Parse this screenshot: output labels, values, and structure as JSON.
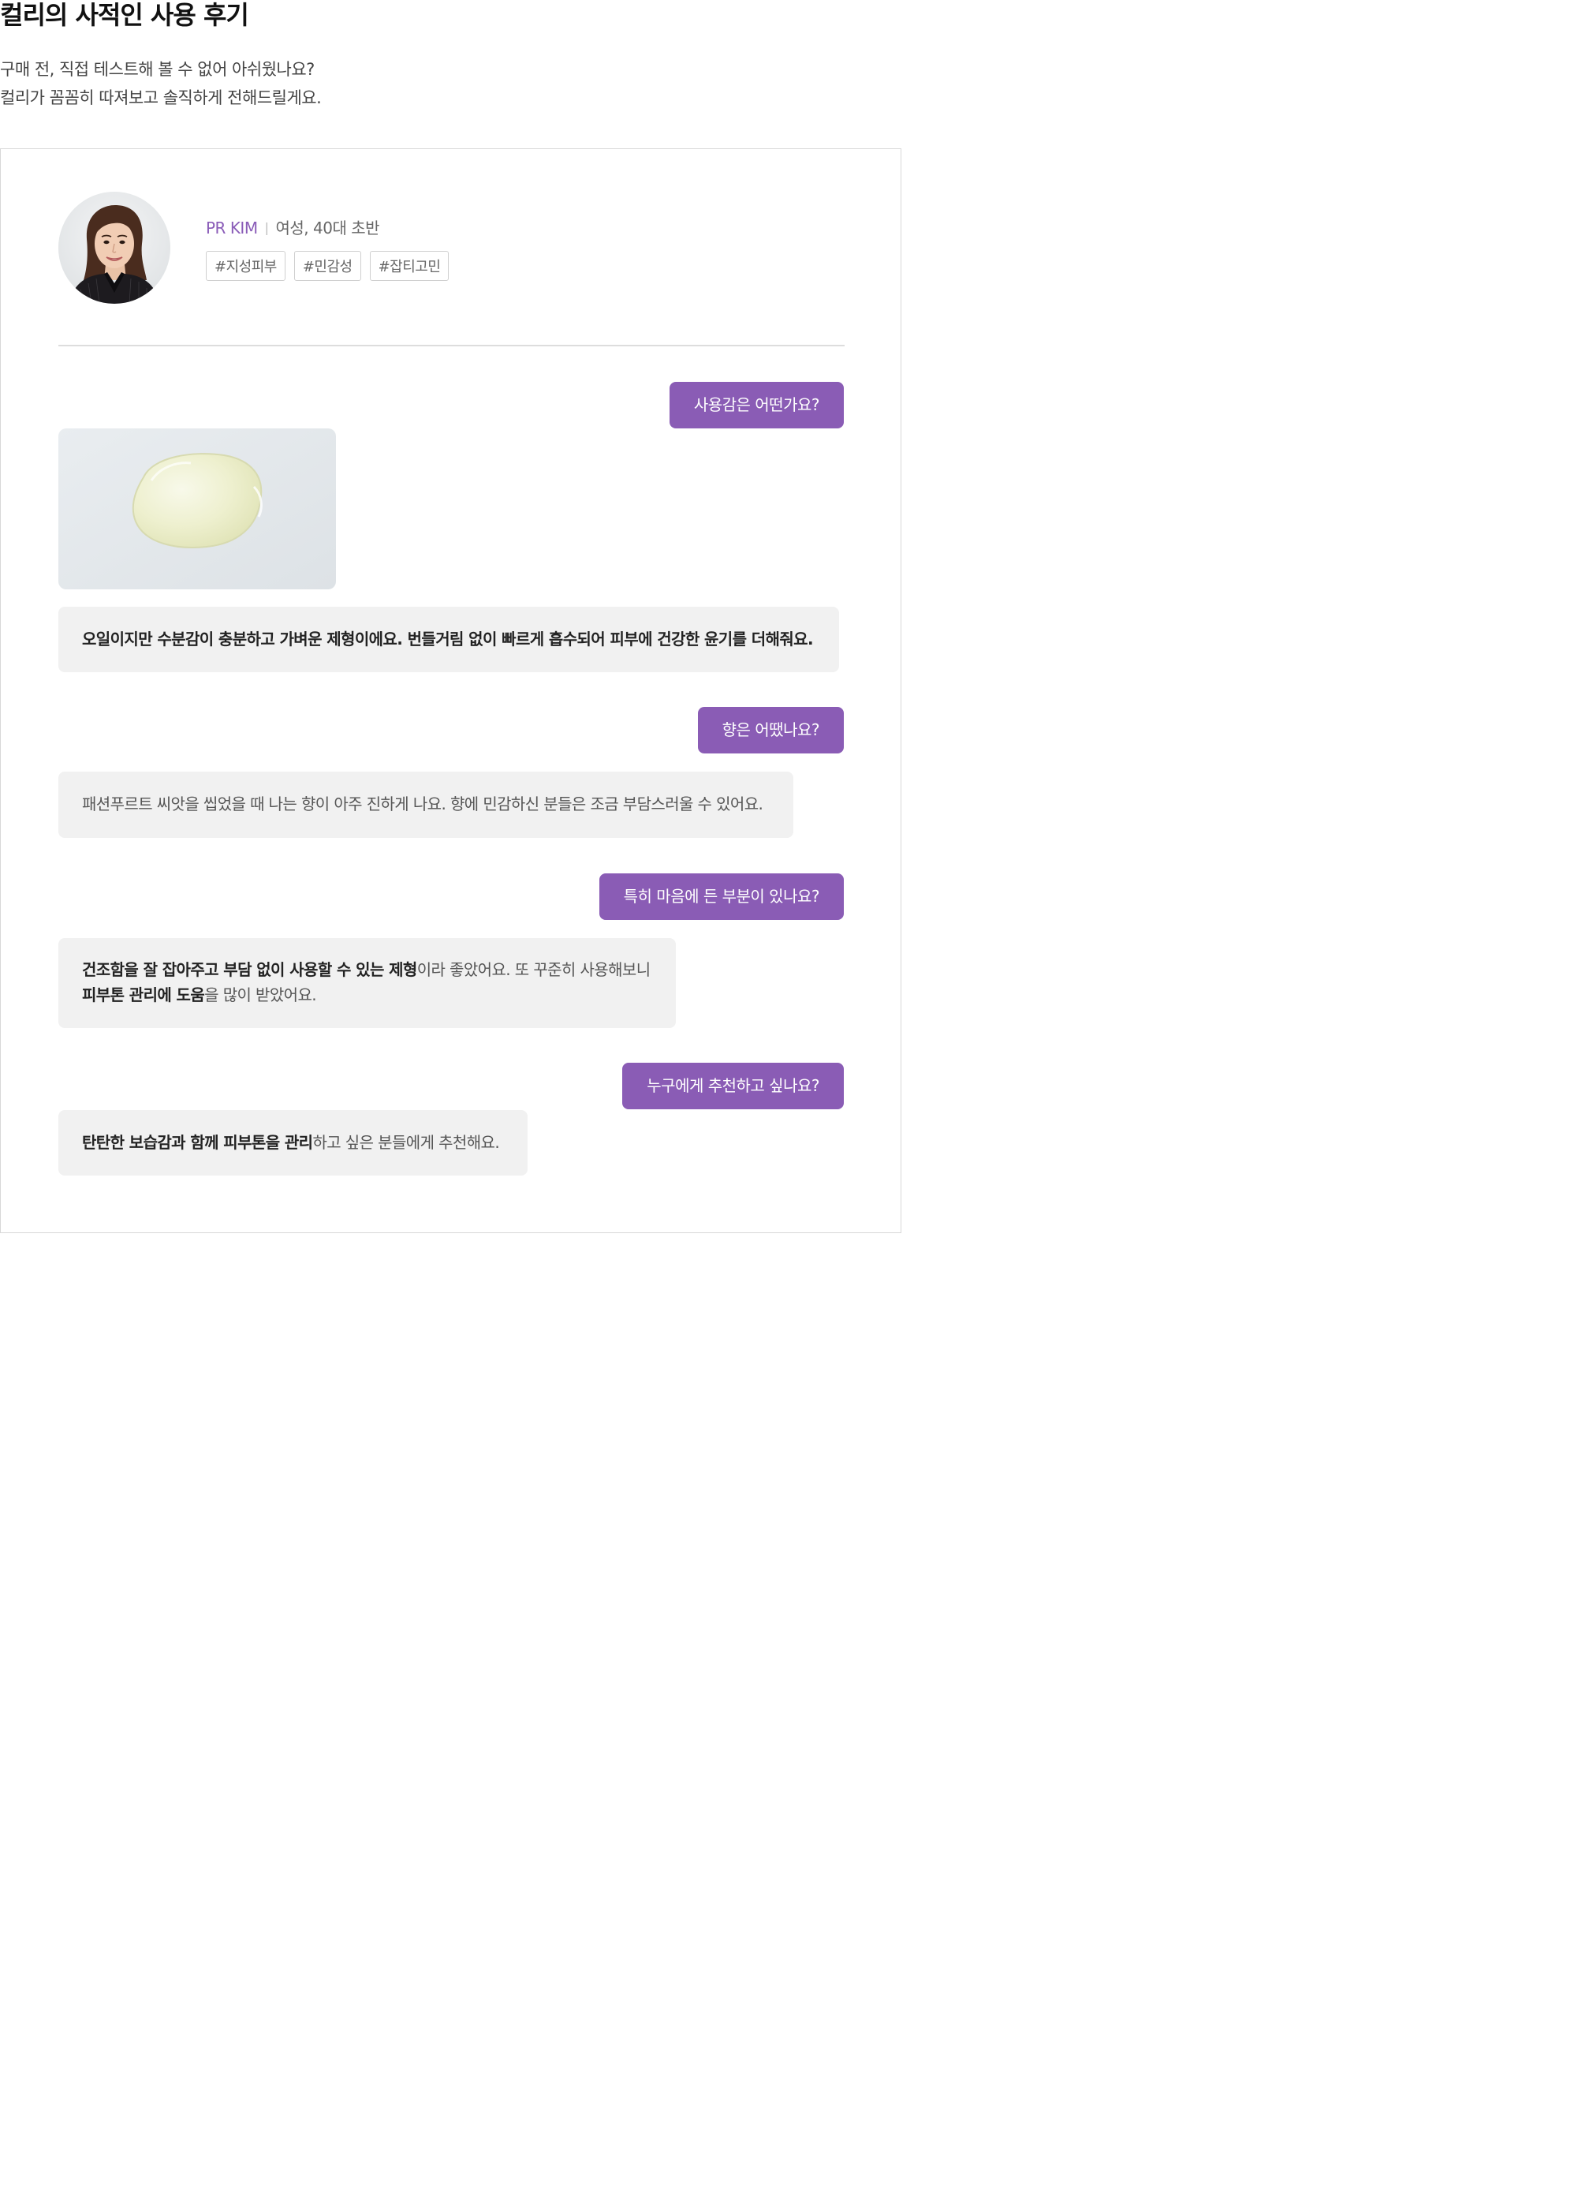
{
  "header": {
    "title": "컬리의 사적인 사용 후기",
    "intro_line1": "구매 전, 직접 테스트해 볼 수 없어 아쉬웠나요?",
    "intro_line2": "컬리가 꼼꼼히 따져보고 솔직하게 전해드릴게요."
  },
  "reviewer": {
    "name": "PR KIM",
    "separator": "|",
    "info": "여성, 40대 초반",
    "avatar": "reviewer-portrait",
    "tags": [
      "#지성피부",
      "#민감성",
      "#잡티고민"
    ]
  },
  "colors": {
    "accent": "#8a5cb5",
    "question_text": "#ffffff",
    "answer_bg": "#f1f1f1",
    "border": "#d8d8d8"
  },
  "conversation": {
    "q1": "사용감은 어떤가요?",
    "photo": "oil-texture-photo",
    "a1": "오일이지만 수분감이 충분하고 가벼운 제형이에요. 번들거림 없이 빠르게 흡수되어 피부에 건강한 윤기를 더해줘요.",
    "q2": "향은 어땠나요?",
    "a2": "패션푸르트 씨앗을 씹었을 때 나는 향이 아주 진하게 나요. 향에 민감하신 분들은 조금 부담스러울 수 있어요.",
    "q3": "특히 마음에 든 부분이 있나요?",
    "a3_line1_bold": "건조함을 잘 잡아주고 부담 없이 사용할 수 있는 제형",
    "a3_line1_rest": "이라 좋았어요. 또 꾸준히 사용해보니",
    "a3_line2_bold": "피부톤 관리에 도움",
    "a3_line2_rest": "을 많이 받았어요.",
    "q4": "누구에게 추천하고 싶나요?",
    "a4_bold": "탄탄한 보습감과 함께 피부톤을 관리",
    "a4_rest": "하고 싶은 분들에게 추천해요."
  }
}
